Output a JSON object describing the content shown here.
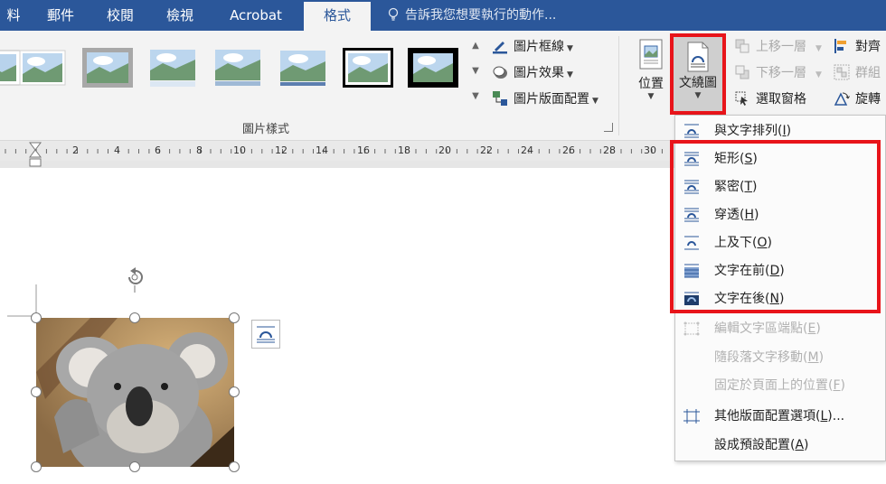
{
  "tabs": [
    "料",
    "郵件",
    "校閱",
    "檢視",
    "Acrobat",
    "格式"
  ],
  "tell_me": "告訴我您想要執行的動作...",
  "ribbon": {
    "picture_border": "圖片框線",
    "picture_effects": "圖片效果",
    "picture_layout": "圖片版面配置",
    "group_label": "圖片樣式",
    "position": "位置",
    "wrap_text": "文繞圖",
    "bring_forward": "上移一層",
    "send_backward": "下移一層",
    "selection_pane": "選取窗格",
    "align": "對齊",
    "group": "群組",
    "rotate": "旋轉"
  },
  "ruler": {
    "labels": [
      "2",
      "4",
      "6",
      "8",
      "10",
      "12",
      "14",
      "16",
      "18",
      "20",
      "22",
      "24",
      "26",
      "28",
      "30"
    ]
  },
  "menu": {
    "items": [
      {
        "label": "與文字排列(I)",
        "base": "與文字排列(",
        "key": "I",
        "end": ")",
        "disabled": false
      },
      {
        "label": "矩形(S)",
        "base": "矩形(",
        "key": "S",
        "end": ")",
        "disabled": false
      },
      {
        "label": "緊密(T)",
        "base": "緊密(",
        "key": "T",
        "end": ")",
        "disabled": false
      },
      {
        "label": "穿透(H)",
        "base": "穿透(",
        "key": "H",
        "end": ")",
        "disabled": false
      },
      {
        "label": "上及下(O)",
        "base": "上及下(",
        "key": "O",
        "end": ")",
        "disabled": false
      },
      {
        "label": "文字在前(D)",
        "base": "文字在前(",
        "key": "D",
        "end": ")",
        "disabled": false
      },
      {
        "label": "文字在後(N)",
        "base": "文字在後(",
        "key": "N",
        "end": ")",
        "disabled": false
      },
      {
        "label": "編輯文字區端點(E)",
        "base": "編輯文字區端點(",
        "key": "E",
        "end": ")",
        "disabled": true
      },
      {
        "label": "隨段落文字移動(M)",
        "base": "隨段落文字移動(",
        "key": "M",
        "end": ")",
        "disabled": true
      },
      {
        "label": "固定於頁面上的位置(F)",
        "base": "固定於頁面上的位置(",
        "key": "F",
        "end": ")",
        "disabled": true
      },
      {
        "label": "其他版面配置選項(L)...",
        "base": "其他版面配置選項(",
        "key": "L",
        "end": ")...",
        "disabled": false
      },
      {
        "label": "設成預設配置(A)",
        "base": "設成預設配置(",
        "key": "A",
        "end": ")",
        "disabled": false
      }
    ]
  },
  "colors": {
    "tab_bar": "#2b579a",
    "highlight_red": "#e8141a",
    "ribbon_bg": "#f3f3f3"
  }
}
